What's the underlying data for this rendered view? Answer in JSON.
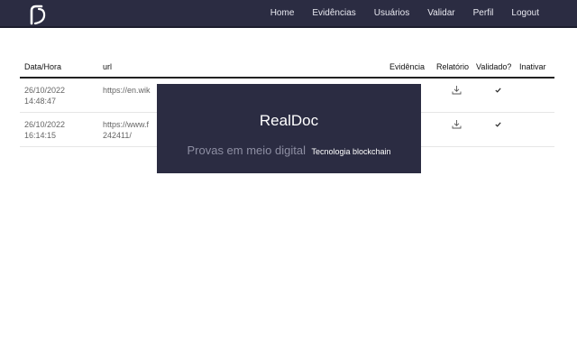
{
  "navbar": {
    "logo_icon": "realdoc-r-logo",
    "links": [
      "Home",
      "Evidências",
      "Usuários",
      "Validar",
      "Perfil",
      "Logout"
    ]
  },
  "table": {
    "headers": {
      "date": "Data/Hora",
      "url": "url",
      "evidence": "Evidência",
      "report": "Relatório",
      "validated": "Validado?",
      "deactivate": "Inativar"
    },
    "rows": [
      {
        "date": "26/10/2022",
        "time": "14:48:47",
        "url": "https://en.wik",
        "url_cont": ""
      },
      {
        "date": "26/10/2022",
        "time": "16:14:15",
        "url": "https://www.f",
        "url_cont": "242411/"
      }
    ]
  },
  "modal": {
    "title": "RealDoc",
    "tagline": "Provas em meio digital",
    "tech": "Tecnologia blockchain"
  },
  "colors": {
    "nav_bg": "#2b2c42",
    "modal_bg": "#2b2c42",
    "tagline": "#8d8ea2"
  }
}
